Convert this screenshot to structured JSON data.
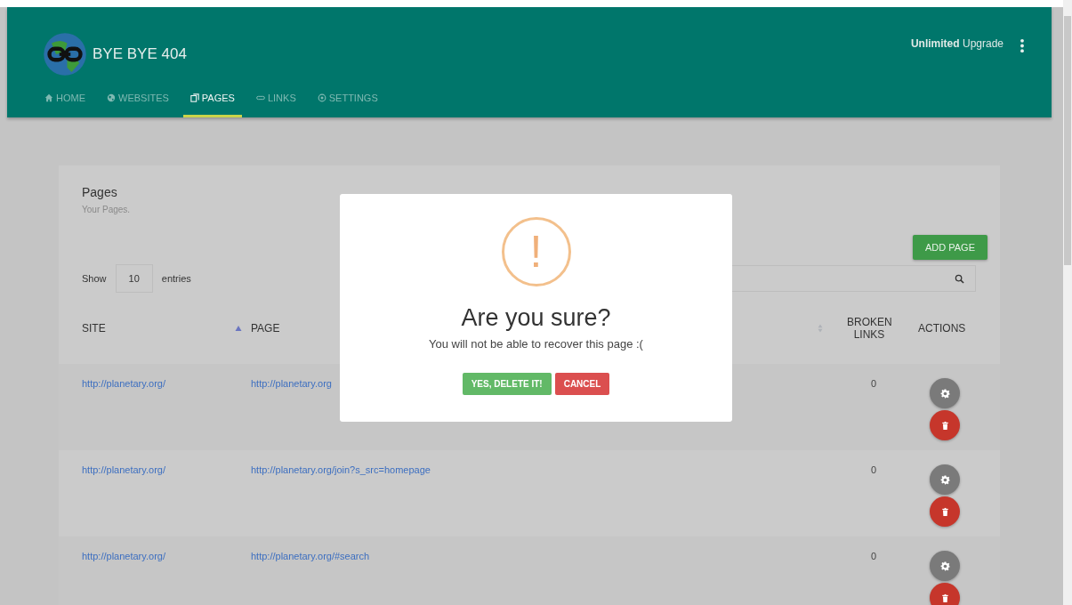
{
  "brand": {
    "name": "BYE BYE 404"
  },
  "header_link": "**Unlimited** Upgrade",
  "nav": [
    {
      "label": "HOME",
      "selected": false
    },
    {
      "label": "WEBSITES",
      "selected": false
    },
    {
      "label": "PAGES",
      "selected": true
    },
    {
      "label": "LINKS",
      "selected": false
    },
    {
      "label": "SETTINGS",
      "selected": false
    }
  ],
  "card": {
    "title": "Pages",
    "subtitle": "Your Pages.",
    "add_button": "ADD PAGE"
  },
  "length": {
    "show": "Show",
    "value": "10",
    "entries": "entries"
  },
  "table": {
    "columns": [
      {
        "label": "SITE"
      },
      {
        "label": "PAGE"
      },
      {
        "label": "BROKEN LINKS"
      },
      {
        "label": "ACTIONS"
      }
    ],
    "rows": [
      {
        "site": "http://planetary.org/",
        "page": "http://planetary.org",
        "broken_links": "0"
      },
      {
        "site": "http://planetary.org/",
        "page": "http://planetary.org/join?s_src=homepage",
        "broken_links": "0"
      },
      {
        "site": "http://planetary.org/",
        "page": "http://planetary.org/#search",
        "broken_links": "0"
      }
    ]
  },
  "dialog": {
    "icon_text": "!",
    "title": "Are you sure?",
    "message": "You will not be able to recover this page :(",
    "confirm": "YES, DELETE IT!",
    "cancel": "CANCEL"
  }
}
